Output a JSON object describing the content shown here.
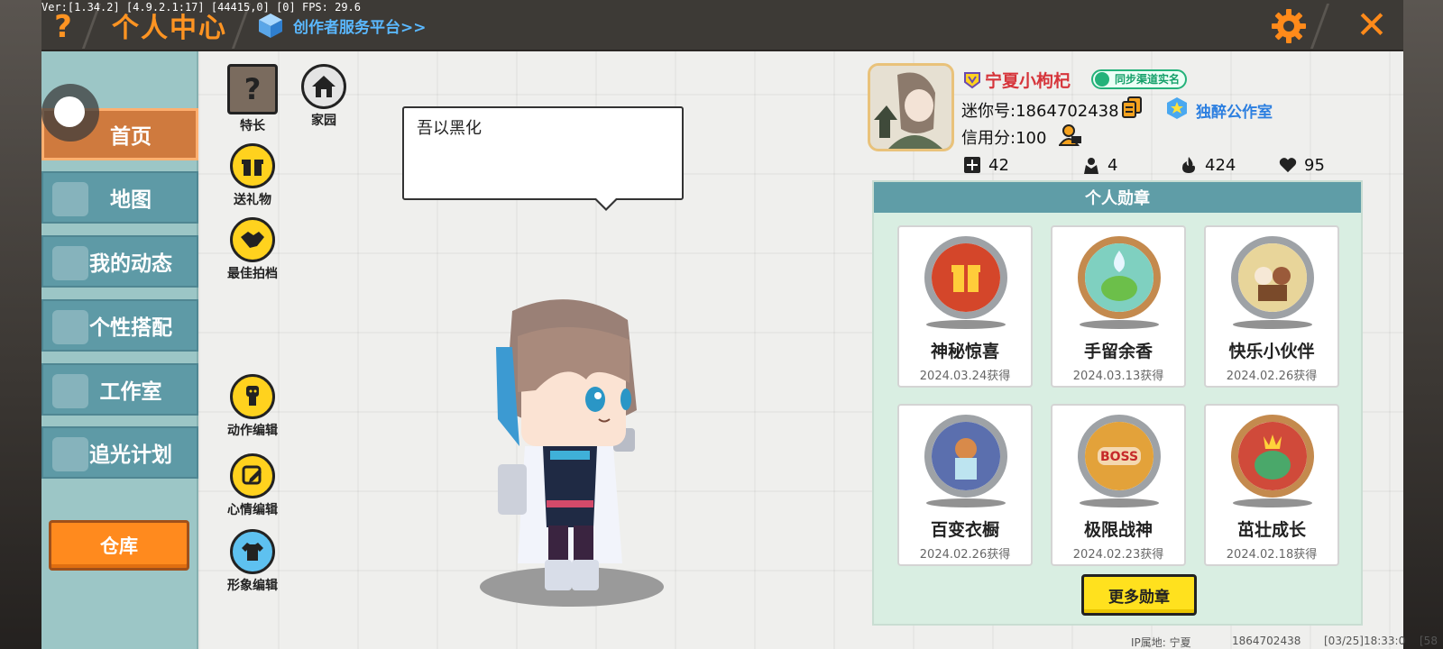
{
  "debug": {
    "fps_line": "Ver:[1.34.2] [4.9.2.1:17] [44415,0] [0] FPS: 29.6"
  },
  "header": {
    "title": "个人中心",
    "creator_link": "创作者服务平台>>",
    "help_glyph": "?",
    "close_glyph": "✕"
  },
  "sidebar": {
    "items": [
      {
        "label": "首页",
        "active": true
      },
      {
        "label": "地图",
        "active": false
      },
      {
        "label": "我的动态",
        "active": false
      },
      {
        "label": "个性搭配",
        "active": false
      },
      {
        "label": "工作室",
        "active": false
      },
      {
        "label": "追光计划",
        "active": false
      }
    ],
    "warehouse": "仓库"
  },
  "functions": {
    "specialty": {
      "label": "特长",
      "glyph": "?"
    },
    "home": {
      "label": "家园"
    },
    "send_gift": {
      "label": "送礼物"
    },
    "best_partner": {
      "label": "最佳拍档"
    },
    "action_edit": {
      "label": "动作编辑"
    },
    "mood_edit": {
      "label": "心情编辑"
    },
    "image_edit": {
      "label": "形象编辑"
    }
  },
  "bubble": {
    "text": "吾以黑化"
  },
  "profile": {
    "username": "宁夏小枸杞",
    "verify_badge": "同步渠道实名",
    "mini_id": "迷你号:1864702438",
    "studio": "独醉公作室",
    "credit": "信用分:100",
    "stats": {
      "follow": "42",
      "fans": "4",
      "heat": "424",
      "likes": "95"
    }
  },
  "medals": {
    "header": "个人勋章",
    "items": [
      {
        "name": "神秘惊喜",
        "date": "2024.03.24获得",
        "frame": "silver",
        "color": "#d4462a"
      },
      {
        "name": "手留余香",
        "date": "2024.03.13获得",
        "frame": "bronze",
        "color": "#7fd0c0"
      },
      {
        "name": "快乐小伙伴",
        "date": "2024.02.26获得",
        "frame": "silver",
        "color": "#c9a64a"
      },
      {
        "name": "百变衣橱",
        "date": "2024.02.26获得",
        "frame": "silver",
        "color": "#5b6fae"
      },
      {
        "name": "极限战神",
        "date": "2024.02.23获得",
        "frame": "silver",
        "color": "#e3a23a"
      },
      {
        "name": "茁壮成长",
        "date": "2024.02.18获得",
        "frame": "bronze",
        "color": "#d04a3a"
      }
    ],
    "more_button": "更多勋章"
  },
  "footer": {
    "ip_location": "IP属地: 宁夏",
    "uid": "1864702438",
    "timestamp": "[03/25]18:33:0",
    "trailing": "[58"
  }
}
